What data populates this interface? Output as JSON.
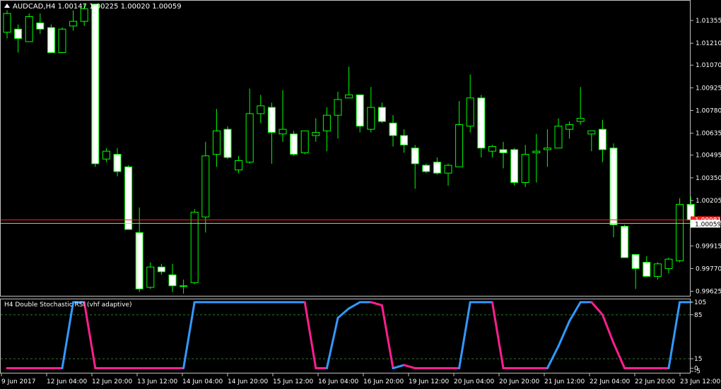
{
  "header": {
    "symbol": "AUDCAD,H4",
    "ohlc": "1.00147 1.00225 1.00020 1.00059"
  },
  "indicator": {
    "title": "H4 Double Stochastic RSI (vhf adaptive)"
  },
  "colors": {
    "bull_candle": "#00ff00",
    "candle_body": "#ffffff",
    "ask_line": "#ff2020",
    "bid_line": "#c0c0c0",
    "up_line": "#3399ff",
    "down_line": "#ff1f8f",
    "level_line": "#2a7a2a"
  },
  "price_axis": {
    "labels": [
      "1.01355",
      "1.01210",
      "1.01070",
      "1.00925",
      "1.00780",
      "1.00635",
      "1.00495",
      "1.00350",
      "1.00205",
      "1.00059",
      "0.99915",
      "0.99770",
      "0.99625"
    ],
    "values": [
      1.01355,
      1.0121,
      1.0107,
      1.00925,
      1.0078,
      1.00635,
      1.00495,
      1.0035,
      1.00205,
      1.00059,
      0.99915,
      0.9977,
      0.99625
    ],
    "current": "1.00059",
    "ask_label": "1.00081",
    "ask": 1.00081,
    "range": [
      0.99605,
      1.0145
    ]
  },
  "indicator_axis": {
    "labels": [
      "105",
      "85",
      "15",
      "0",
      "-5"
    ],
    "values": [
      105,
      85,
      15,
      0,
      -5
    ],
    "levels": [
      85,
      15
    ]
  },
  "time_axis": {
    "labels": [
      "9 Jun 2017",
      "12 Jun 04:00",
      "12 Jun 20:00",
      "13 Jun 12:00",
      "14 Jun 04:00",
      "14 Jun 20:00",
      "15 Jun 12:00",
      "16 Jun 04:00",
      "16 Jun 20:00",
      "19 Jun 12:00",
      "20 Jun 04:00",
      "20 Jun 20:00",
      "21 Jun 12:00",
      "22 Jun 04:00",
      "22 Jun 20:00",
      "23 Jun 12:00"
    ]
  },
  "chart_data": {
    "type": "candlestick",
    "candles": [
      [
        1.0128,
        1.0142,
        1.0124,
        1.014
      ],
      [
        1.013,
        1.0133,
        1.0115,
        1.0124
      ],
      [
        1.0122,
        1.014,
        1.0122,
        1.0138
      ],
      [
        1.0134,
        1.014,
        1.0127,
        1.013
      ],
      [
        1.0131,
        1.0133,
        1.0115,
        1.0115
      ],
      [
        1.0115,
        1.0131,
        1.0115,
        1.013
      ],
      [
        1.0132,
        1.0142,
        1.0129,
        1.0135
      ],
      [
        1.0135,
        1.0146,
        1.0132,
        1.0143
      ],
      [
        1.0146,
        1.0146,
        1.0042,
        1.0044
      ],
      [
        1.0047,
        1.0054,
        1.0045,
        1.0052
      ],
      [
        1.005,
        1.0054,
        1.0036,
        1.0039
      ],
      [
        1.0042,
        1.0043,
        1.0002,
        1.0002
      ],
      [
        1.0,
        1.0016,
        0.9962,
        0.9964
      ],
      [
        0.9965,
        0.9981,
        0.9964,
        0.9978
      ],
      [
        0.9978,
        0.998,
        0.9973,
        0.9975
      ],
      [
        0.9973,
        0.998,
        0.9962,
        0.9966
      ],
      [
        0.9966,
        0.997,
        0.9961,
        0.9966
      ],
      [
        0.9968,
        1.0015,
        0.9967,
        1.0013
      ],
      [
        1.001,
        1.0058,
        1.0,
        1.0049
      ],
      [
        1.005,
        1.0079,
        1.0042,
        1.0065
      ],
      [
        1.0066,
        1.0068,
        1.0047,
        1.0048
      ],
      [
        1.004,
        1.0049,
        1.0038,
        1.0046
      ],
      [
        1.0045,
        1.0092,
        1.0044,
        1.0076
      ],
      [
        1.0076,
        1.0088,
        1.007,
        1.0081
      ],
      [
        1.008,
        1.0083,
        1.0044,
        1.0064
      ],
      [
        1.0063,
        1.0091,
        1.0058,
        1.0066
      ],
      [
        1.0063,
        1.0065,
        1.0049,
        1.005
      ],
      [
        1.0051,
        1.0063,
        1.005,
        1.0065
      ],
      [
        1.0062,
        1.0073,
        1.0058,
        1.0064
      ],
      [
        1.0065,
        1.008,
        1.0052,
        1.0075
      ],
      [
        1.0075,
        1.009,
        1.006,
        1.0085
      ],
      [
        1.0086,
        1.0106,
        1.0086,
        1.0088
      ],
      [
        1.0088,
        1.0088,
        1.0064,
        1.0068
      ],
      [
        1.0066,
        1.0093,
        1.0064,
        1.008
      ],
      [
        1.008,
        1.0083,
        1.007,
        1.0071
      ],
      [
        1.007,
        1.0075,
        1.0055,
        1.0062
      ],
      [
        1.0062,
        1.0066,
        1.0051,
        1.0056
      ],
      [
        1.0054,
        1.0056,
        1.0028,
        1.0044
      ],
      [
        1.0043,
        1.0044,
        1.0038,
        1.0039
      ],
      [
        1.0045,
        1.0048,
        1.0037,
        1.0038
      ],
      [
        1.0038,
        1.0044,
        1.003,
        1.0043
      ],
      [
        1.0042,
        1.0084,
        1.0043,
        1.0069
      ],
      [
        1.0068,
        1.0101,
        1.0064,
        1.0086
      ],
      [
        1.0086,
        1.0088,
        1.0048,
        1.0054
      ],
      [
        1.0052,
        1.0056,
        1.0048,
        1.0055
      ],
      [
        1.0053,
        1.0058,
        1.0041,
        1.0051
      ],
      [
        1.0053,
        1.0054,
        1.003,
        1.0032
      ],
      [
        1.0032,
        1.0056,
        1.0029,
        1.005
      ],
      [
        1.0051,
        1.0063,
        1.0032,
        1.0052
      ],
      [
        1.0053,
        1.0066,
        1.0042,
        1.0054
      ],
      [
        1.0054,
        1.0073,
        1.0054,
        1.0068
      ],
      [
        1.0066,
        1.0071,
        1.006,
        1.0069
      ],
      [
        1.0071,
        1.0093,
        1.0069,
        1.0073
      ],
      [
        1.0063,
        1.0065,
        1.0052,
        1.0065
      ],
      [
        1.0066,
        1.0072,
        1.0045,
        1.0053
      ],
      [
        1.0054,
        1.0057,
        0.9997,
        1.0005
      ],
      [
        1.0004,
        1.0005,
        0.9987,
        0.9984
      ],
      [
        0.9986,
        0.9986,
        0.9964,
        0.9977
      ],
      [
        0.9981,
        0.9985,
        0.9973,
        0.9972
      ],
      [
        0.9972,
        0.9981,
        0.997,
        0.998
      ],
      [
        0.9977,
        0.9984,
        0.9974,
        0.9983
      ],
      [
        0.9982,
        1.0022,
        0.9981,
        1.0018
      ],
      [
        1.0018,
        1.0023,
        1.0003,
        1.0008
      ]
    ],
    "indicator_series": [
      0,
      0,
      0,
      0,
      0,
      0,
      105,
      105,
      0,
      0,
      0,
      0,
      0,
      0,
      0,
      0,
      0,
      105,
      105,
      105,
      105,
      105,
      105,
      105,
      105,
      105,
      105,
      105,
      0,
      0,
      80,
      95,
      105,
      105,
      100,
      0,
      5,
      0,
      0,
      0,
      0,
      0,
      105,
      105,
      105,
      0,
      0,
      0,
      0,
      0,
      35,
      75,
      105,
      105,
      85,
      40,
      0,
      0,
      0,
      0,
      0,
      105,
      105
    ]
  }
}
